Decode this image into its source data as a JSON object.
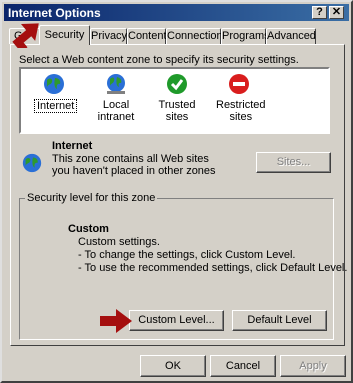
{
  "window": {
    "title": "Internet Options",
    "help_glyph": "?",
    "close_glyph": "✕"
  },
  "tabs": [
    {
      "label": "General",
      "visible_text": "Ge"
    },
    {
      "label": "Security",
      "visible_text": "Security",
      "active": true
    },
    {
      "label": "Privacy",
      "visible_text": "Privacy"
    },
    {
      "label": "Content",
      "visible_text": "Content"
    },
    {
      "label": "Connections",
      "visible_text": "Connections"
    },
    {
      "label": "Programs",
      "visible_text": "Programs"
    },
    {
      "label": "Advanced",
      "visible_text": "Advanced"
    }
  ],
  "security": {
    "instruction": "Select a Web content zone to specify its security settings.",
    "zones": [
      {
        "label": "Internet",
        "icon": "globe-icon",
        "selected": true
      },
      {
        "label": "Local intranet",
        "icon": "globe-network-icon"
      },
      {
        "label": "Trusted sites",
        "icon": "checkmark-icon"
      },
      {
        "label": "Restricted sites",
        "icon": "no-entry-icon"
      }
    ],
    "zone_info": {
      "name": "Internet",
      "description": "This zone contains all Web sites you haven't placed in other zones"
    },
    "sites_button": "Sites...",
    "level_group": {
      "title": "Security level for this zone",
      "level_name": "Custom",
      "lines": [
        "Custom settings.",
        "- To change the settings, click Custom Level.",
        "- To use the recommended settings, click Default Level."
      ],
      "custom_button": "Custom Level...",
      "default_button": "Default Level"
    }
  },
  "footer": {
    "ok": "OK",
    "cancel": "Cancel",
    "apply": "Apply"
  },
  "colors": {
    "annotation_arrow": "#a50f0f",
    "titlebar": "#0a246a",
    "face": "#d4d0c8"
  }
}
